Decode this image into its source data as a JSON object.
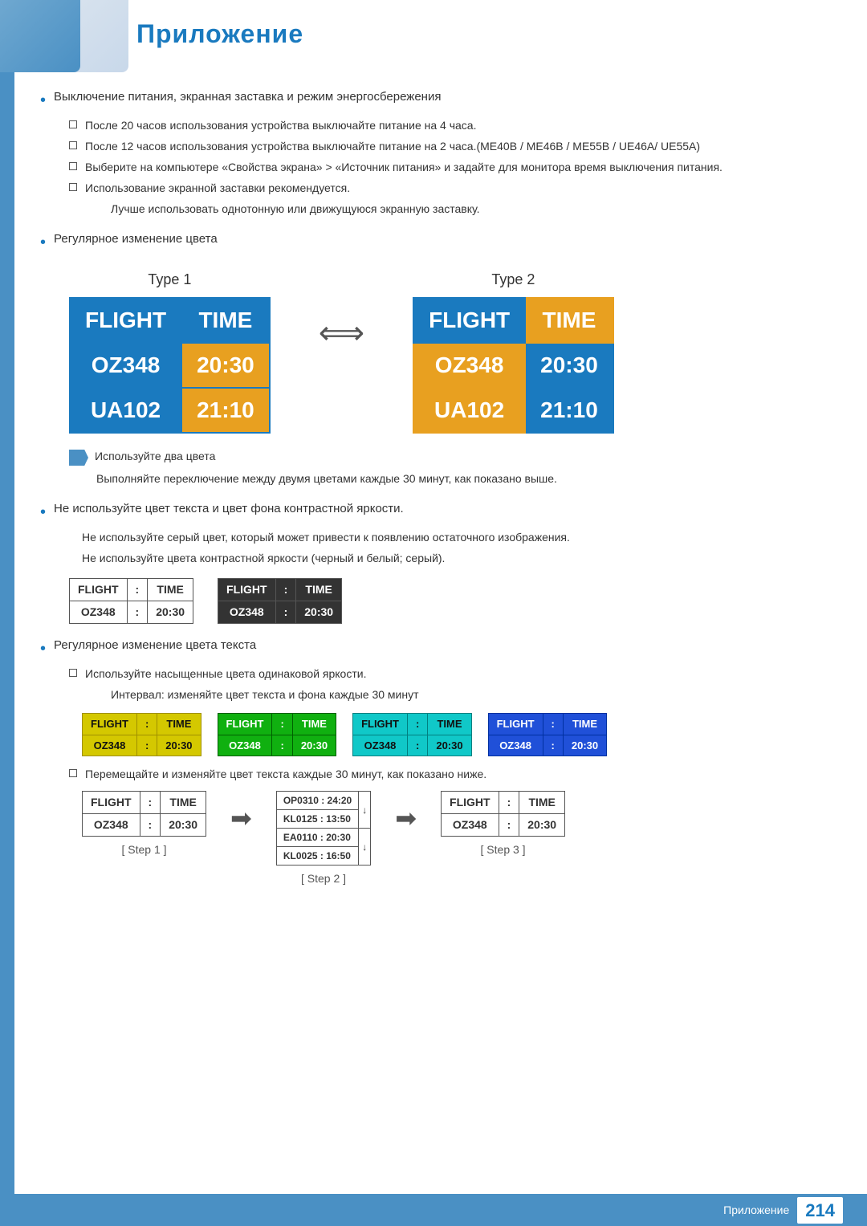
{
  "page": {
    "title": "Приложение",
    "footer_label": "Приложение",
    "footer_number": "214"
  },
  "sections": {
    "bullet1": {
      "main": "Выключение питания, экранная заставка и режим энергосбережения",
      "subs": [
        "После 20 часов использования устройства выключайте питание на 4 часа.",
        "После 12 часов использования устройства выключайте питание на 2 часа.(ME40B / ME46B / ME55B / UE46A/ UE55A)",
        "Выберите на компьютере «Свойства экрана» > «Источник питания» и задайте для монитора время выключения питания.",
        "Использование экранной заставки рекомендуется."
      ],
      "indent": "Лучше использовать однотонную или движущуюся экранную заставку."
    },
    "bullet2": {
      "main": "Регулярное изменение цвета"
    },
    "type1_label": "Type 1",
    "type2_label": "Type 2",
    "type1_rows": [
      [
        "FLIGHT",
        "TIME"
      ],
      [
        "OZ348",
        "20:30"
      ],
      [
        "UA102",
        "21:10"
      ]
    ],
    "type2_rows": [
      [
        "FLIGHT",
        "TIME"
      ],
      [
        "OZ348",
        "20:30"
      ],
      [
        "UA102",
        "21:10"
      ]
    ],
    "note1": "Используйте два цвета",
    "note2": "Выполняйте переключение между двумя цветами каждые 30 минут, как показано выше.",
    "bullet3": {
      "main": "Не используйте цвет текста и цвет фона контрастной яркости.",
      "indent1": "Не используйте серый цвет, который может привести к появлению остаточного изображения.",
      "indent2": "Не используйте цвета контрастной яркости (черный и белый; серый)."
    },
    "small_table1": {
      "row1": [
        "FLIGHT",
        ":",
        "TIME"
      ],
      "row2": [
        "OZ348",
        ":",
        "20:30"
      ]
    },
    "small_table2": {
      "row1": [
        "FLIGHT",
        ":",
        "TIME"
      ],
      "row2": [
        "OZ348",
        ":",
        "20:30"
      ]
    },
    "bullet4": {
      "main": "Регулярное изменение цвета текста",
      "sub": "Используйте насыщенные цвета одинаковой яркости.",
      "indent": "Интервал: изменяйте цвет текста и фона каждые 30 минут"
    },
    "colored_tables": [
      {
        "color_class": "ct-yellow",
        "border_class": "ct-yellow-border",
        "rows": [
          [
            "FLIGHT",
            ":",
            "TIME"
          ],
          [
            "OZ348",
            ":",
            "20:30"
          ]
        ]
      },
      {
        "color_class": "ct-green",
        "border_class": "ct-green-border",
        "rows": [
          [
            "FLIGHT",
            ":",
            "TIME"
          ],
          [
            "OZ348",
            ":",
            "20:30"
          ]
        ]
      },
      {
        "color_class": "ct-cyan",
        "border_class": "ct-cyan-border",
        "rows": [
          [
            "FLIGHT",
            ":",
            "TIME"
          ],
          [
            "OZ348",
            ":",
            "20:30"
          ]
        ]
      },
      {
        "color_class": "ct-blue",
        "border_class": "ct-blue-border",
        "rows": [
          [
            "FLIGHT",
            ":",
            "TIME"
          ],
          [
            "OZ348",
            ":",
            "20:30"
          ]
        ]
      }
    ],
    "bullet4_sub2": "Перемещайте и изменяйте цвет текста каждые 30 минут, как показано ниже.",
    "step1_label": "[ Step 1 ]",
    "step2_label": "[ Step 2 ]",
    "step3_label": "[ Step 3 ]",
    "step1_table": {
      "row1": [
        "FLIGHT",
        ":",
        "TIME"
      ],
      "row2": [
        "OZ348",
        ":",
        "20:30"
      ]
    },
    "step2_table": {
      "row1": [
        "OP0310 : 24:20"
      ],
      "row2": [
        "KL0125 : 13:50"
      ],
      "row3": [
        "EA0110 : 20:30"
      ],
      "row4": [
        "KL0025 : 16:50"
      ]
    },
    "step3_table": {
      "row1": [
        "FLIGHT",
        ":",
        "TIME"
      ],
      "row2": [
        "OZ348",
        ":",
        "20:30"
      ]
    }
  }
}
